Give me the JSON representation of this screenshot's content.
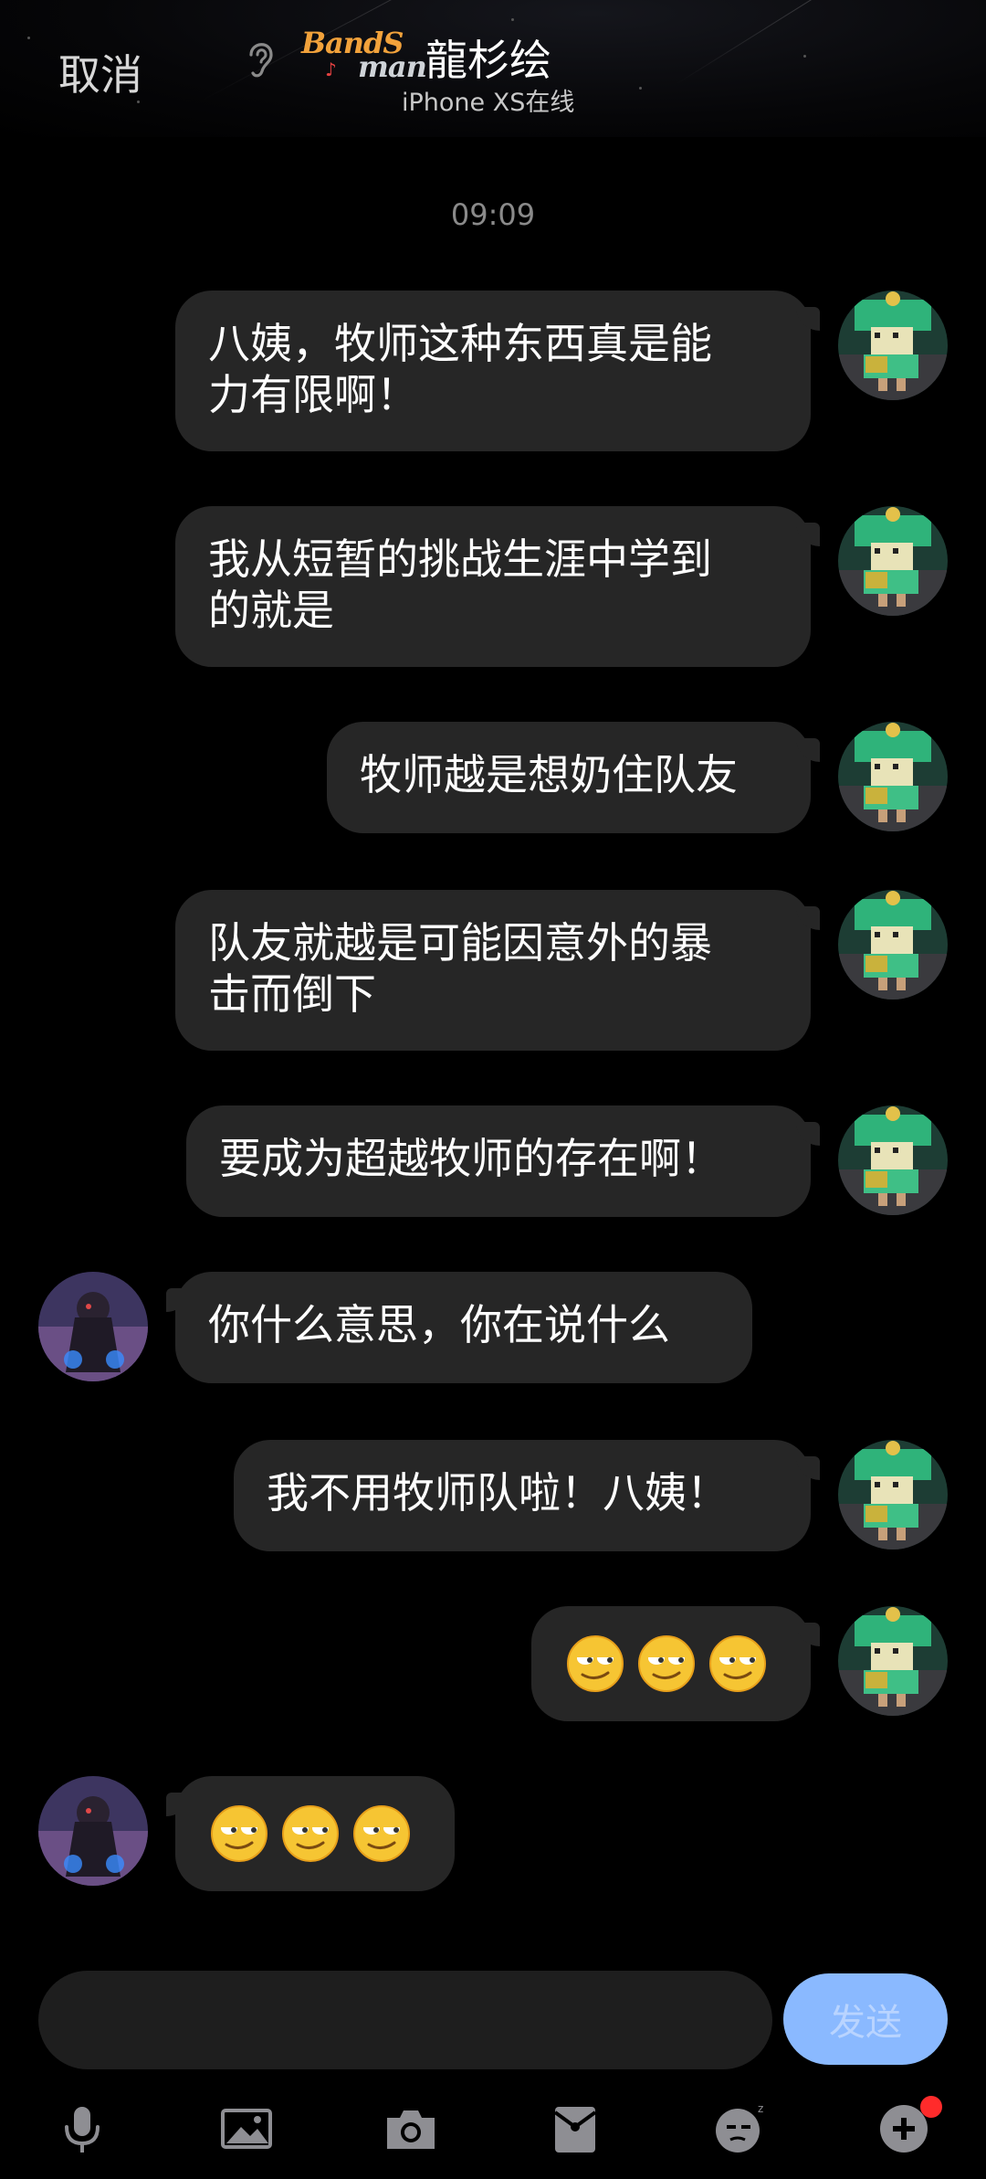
{
  "header": {
    "cancel_label": "取消",
    "badge_line1": "BandS",
    "badge_line2": "man",
    "nickname": "龍杉绘",
    "device_status": "iPhone XS在线"
  },
  "chat": {
    "timestamp": "09:09",
    "messages": [
      {
        "side": "right",
        "lines": [
          "八姨，牧师这种东西真是能",
          "力有限啊！"
        ]
      },
      {
        "side": "right",
        "lines": [
          "我从短暂的挑战生涯中学到",
          "的就是"
        ]
      },
      {
        "side": "right",
        "lines": [
          "牧师越是想奶住队友"
        ]
      },
      {
        "side": "right",
        "lines": [
          "队友就越是可能因意外的暴",
          "击而倒下"
        ]
      },
      {
        "side": "right",
        "lines": [
          "要成为超越牧师的存在啊！"
        ]
      },
      {
        "side": "left",
        "lines": [
          "你什么意思，你在说什么"
        ]
      },
      {
        "side": "right",
        "lines": [
          "我不用牧师队啦！八姨！"
        ]
      },
      {
        "side": "right",
        "emoji": "smirk-emoji",
        "count": 3
      },
      {
        "side": "left",
        "emoji": "smirk-emoji",
        "count": 3
      }
    ]
  },
  "composer": {
    "input_value": "",
    "input_placeholder": "",
    "send_label": "发送"
  },
  "toolbar": {
    "icons": [
      "microphone-icon",
      "image-icon",
      "camera-icon",
      "red-packet-icon",
      "emoji-face-icon",
      "plus-icon"
    ]
  },
  "colors": {
    "background": "#000000",
    "bubble": "#262626",
    "send_button": "#8ab9ff",
    "notification_dot": "#ff2b2b"
  }
}
